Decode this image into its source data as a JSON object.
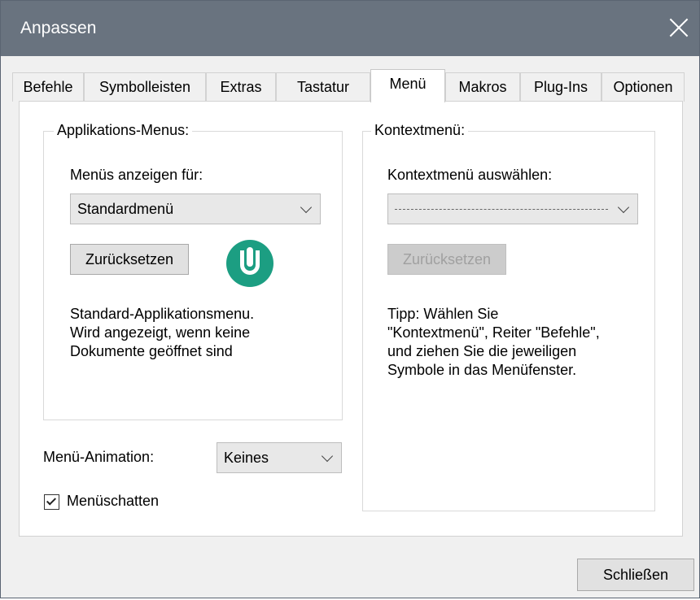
{
  "window": {
    "title": "Anpassen"
  },
  "tabs": [
    "Befehle",
    "Symbolleisten",
    "Extras",
    "Tastatur",
    "Menü",
    "Makros",
    "Plug-Ins",
    "Optionen"
  ],
  "active_tab": "Menü",
  "app_menus": {
    "group_title": "Applikations-Menus:",
    "show_for_label": "Menüs anzeigen für:",
    "selected_menu": "Standardmenü",
    "reset_label": "Zurücksetzen",
    "description": [
      "Standard-Applikationsmenu.",
      "Wird angezeigt, wenn keine",
      "Dokumente geöffnet sind"
    ]
  },
  "context_menu": {
    "group_title": "Kontextmenü:",
    "select_label": "Kontextmenü auswählen:",
    "selected_value": "-----------------------------------------------",
    "reset_label": "Zurücksetzen",
    "tip": [
      "Tipp: Wählen Sie",
      "\"Kontextmenü\", Reiter \"Befehle\",",
      "und ziehen Sie die jeweiligen",
      "Symbole in das Menüfenster."
    ]
  },
  "animation": {
    "label": "Menü-Animation:",
    "value": "Keines"
  },
  "shadow": {
    "label": "Menüschatten",
    "checked": true
  },
  "footer": {
    "close_label": "Schließen"
  }
}
